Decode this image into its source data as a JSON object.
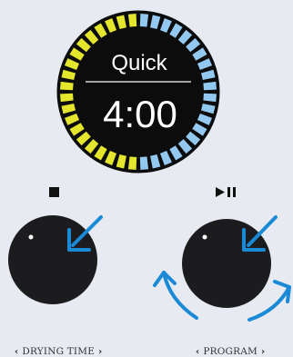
{
  "display": {
    "mode": "Quick",
    "time": "4:00",
    "ring_colors": {
      "elapsed": "#e3e62d",
      "remaining": "#93c9f0",
      "face": "#0c0c0c"
    },
    "progress_fraction": 0.5
  },
  "controls": {
    "stop_icon": "stop-icon",
    "play_pause_icon": "play-pause-icon"
  },
  "knobs": {
    "drying_time": {
      "label": "DRYING TIME",
      "arrow_color": "#1a8ad6"
    },
    "program": {
      "label": "PROGRAM",
      "arrow_color": "#1a8ad6"
    }
  }
}
